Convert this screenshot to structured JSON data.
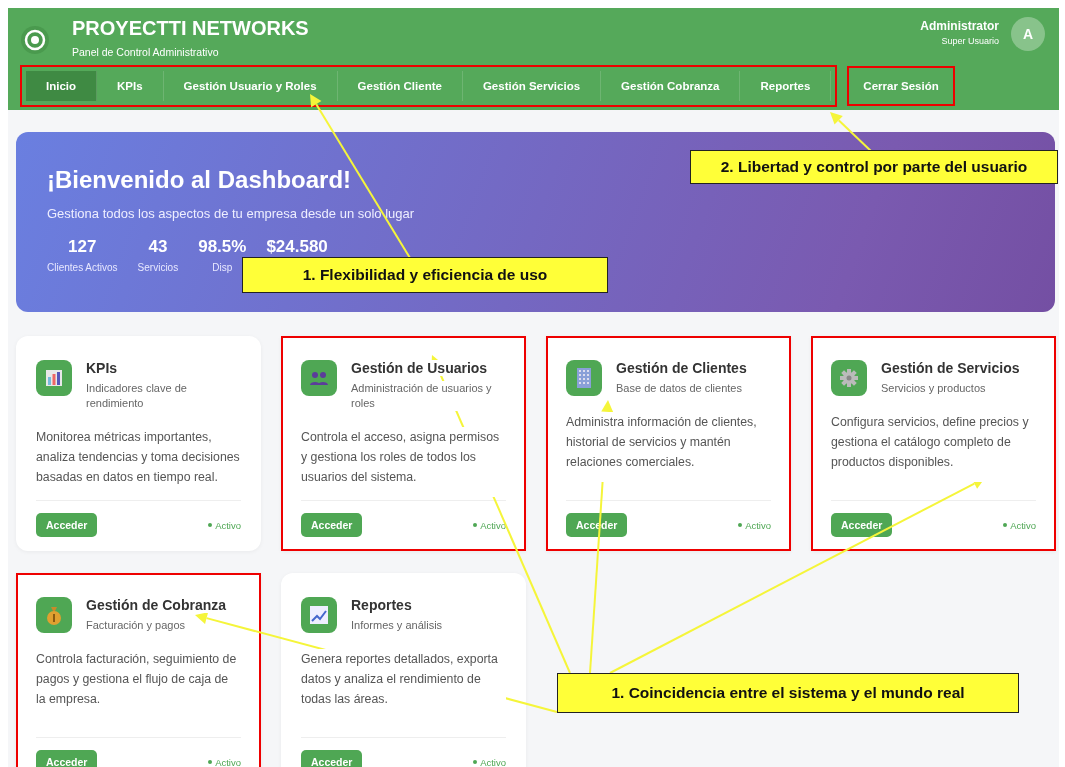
{
  "header": {
    "title": "PROYECTTI NETWORKS",
    "subtitle": "Panel de Control Administrativo",
    "user": {
      "name": "Administrator",
      "role": "Super Usuario",
      "avatar": "A"
    }
  },
  "nav": {
    "highlighted": true,
    "tabs": [
      {
        "label": "Inicio",
        "selected": true
      },
      {
        "label": "KPIs",
        "selected": false
      },
      {
        "label": "Gestión Usuario y Roles",
        "selected": false
      },
      {
        "label": "Gestión Cliente",
        "selected": false
      },
      {
        "label": "Gestión Servicios",
        "selected": false
      },
      {
        "label": "Gestión Cobranza",
        "selected": false
      },
      {
        "label": "Reportes",
        "selected": false
      }
    ],
    "logout": {
      "label": "Cerrar Sesión",
      "highlighted": true
    }
  },
  "banner": {
    "title": "¡Bienvenido al Dashboard!",
    "subtitle": "Gestiona todos los aspectos de tu empresa desde un solo lugar",
    "stats": [
      {
        "value": "127",
        "label": "Clientes Activos"
      },
      {
        "value": "43",
        "label": "Servicios"
      },
      {
        "value": "98.5%",
        "label": "Disp"
      },
      {
        "value": "$24.580"
      }
    ]
  },
  "cards": [
    {
      "title": "KPIs",
      "subtitle": "Indicadores clave de rendimiento",
      "description": "Monitorea métricas importantes, analiza tendencias y toma decisiones basadas en datos en tiempo real.",
      "button": "Acceder",
      "status": "Activo",
      "highlighted": false
    },
    {
      "title": "Gestión de Usuarios",
      "subtitle": "Administración de usuarios y roles",
      "description": "Controla el acceso, asigna permisos y gestiona los roles de todos los usuarios del sistema.",
      "button": "Acceder",
      "status": "Activo",
      "highlighted": true
    },
    {
      "title": "Gestión de Clientes",
      "subtitle": "Base de datos de clientes",
      "description": "Administra información de clientes, historial de servicios y mantén relaciones comerciales.",
      "button": "Acceder",
      "status": "Activo",
      "highlighted": true
    },
    {
      "title": "Gestión de Servicios",
      "subtitle": "Servicios y productos",
      "description": "Configura servicios, define precios y gestiona el catálogo completo de productos disponibles.",
      "button": "Acceder",
      "status": "Activo",
      "highlighted": true
    },
    {
      "title": "Gestión de Cobranza",
      "subtitle": "Facturación y pagos",
      "description": "Controla facturación, seguimiento de pagos y gestiona el flujo de caja de la empresa.",
      "button": "Acceder",
      "status": "Activo",
      "highlighted": true
    },
    {
      "title": "Reportes",
      "subtitle": "Informes y análisis",
      "description": "Genera reportes detallados, exporta datos y analiza el rendimiento de todas las áreas.",
      "button": "Acceder",
      "status": "Activo",
      "highlighted": false
    }
  ],
  "annotations": [
    {
      "text": "1. Flexibilidad y eficiencia de uso"
    },
    {
      "text": "2. Libertad y control por parte del usuario"
    },
    {
      "text": "1. Coincidencia entre el sistema y el mundo real"
    }
  ]
}
